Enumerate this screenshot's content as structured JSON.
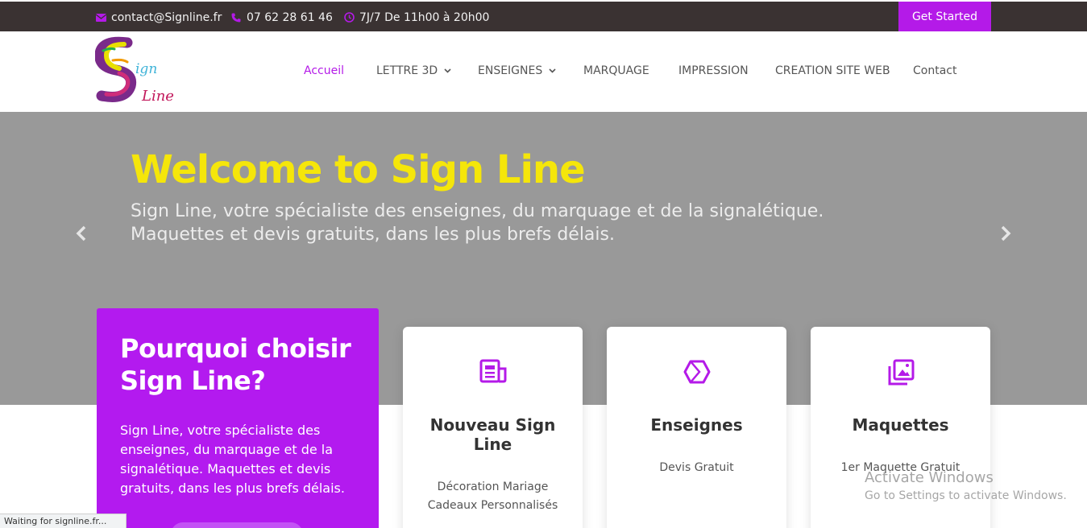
{
  "topbar": {
    "email": "contact@Signline.fr",
    "phone": "07 62 28 61 46",
    "hours": "7J/7 De 11h00 à 20h00",
    "cta_label": "Get Started"
  },
  "header": {
    "nav": [
      {
        "label": "Accueil",
        "active": true
      },
      {
        "label": "LETTRE 3D",
        "dropdown": true
      },
      {
        "label": "ENSEIGNES",
        "dropdown": true
      },
      {
        "label": "MARQUAGE"
      },
      {
        "label": "IMPRESSION"
      },
      {
        "label": "CREATION SITE WEB"
      },
      {
        "label": "Contact"
      }
    ]
  },
  "hero": {
    "title": "Welcome to Sign Line",
    "subtitle_line1": "Sign Line, votre spécialiste des enseignes, du marquage et de la signalétique.",
    "subtitle_line2": "Maquettes et devis gratuits, dans les plus brefs délais."
  },
  "why": {
    "title": "Pourquoi choisir Sign Line?",
    "text": "Sign Line, votre spécialiste des enseignes, du marquage et de la signalétique. Maquettes et devis gratuits, dans les plus brefs délais."
  },
  "features": [
    {
      "title": "Nouveau Sign Line",
      "lines": [
        "Décoration Mariage",
        "Cadeaux Personnalisés"
      ],
      "icon": "newspaper-icon"
    },
    {
      "title": "Enseignes",
      "lines": [
        "Devis Gratuit"
      ],
      "icon": "cube-icon"
    },
    {
      "title": "Maquettes",
      "lines": [
        "1er Maquette Gratuit"
      ],
      "icon": "images-icon"
    }
  ],
  "watermark": {
    "line1": "Activate Windows",
    "line2": "Go to Settings to activate Windows."
  },
  "status": "Waiting for signline.fr...",
  "colors": {
    "accent": "#b41ae8",
    "topbar_bg": "#3a3232",
    "hero_bg": "#999999",
    "hero_title": "#f5e60a"
  }
}
